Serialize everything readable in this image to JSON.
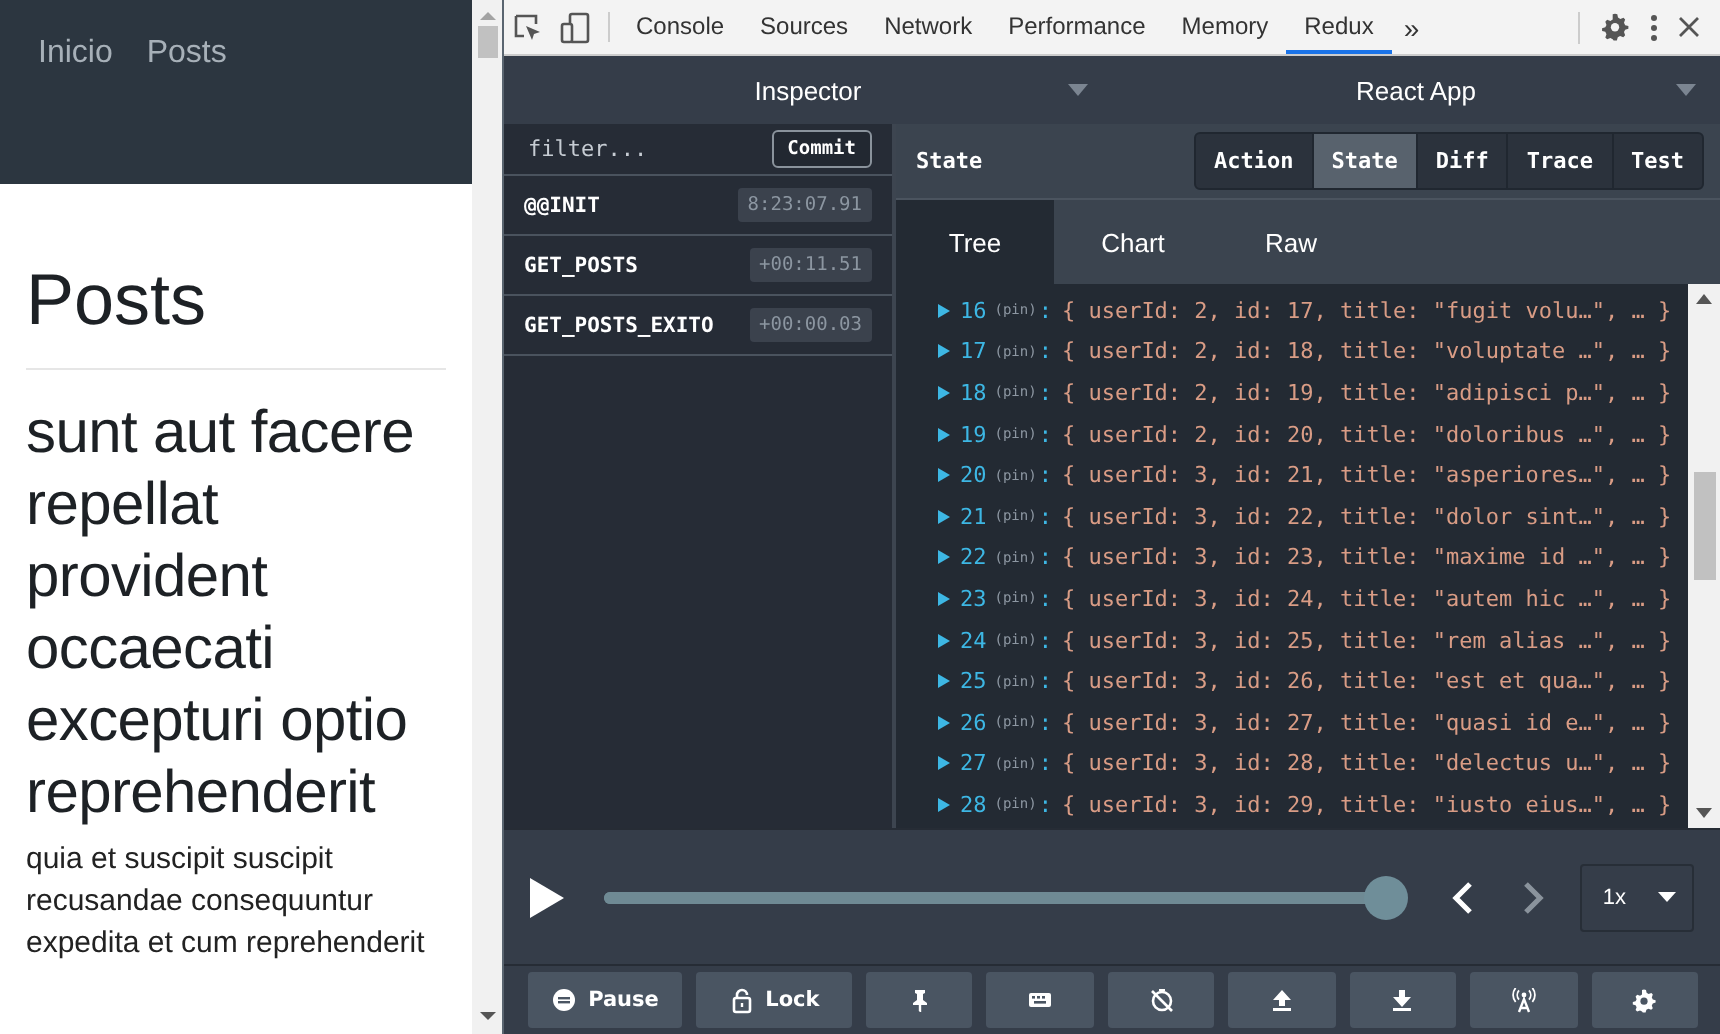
{
  "site": {
    "nav": [
      {
        "label": "Inicio"
      },
      {
        "label": "Posts"
      }
    ],
    "heading": "Posts",
    "post_title": "sunt aut facere repellat provident occaecati excepturi optio reprehenderit",
    "post_body": "quia et suscipit suscipit recusandae consequuntur expedita et cum reprehenderit"
  },
  "devtools_tabs": [
    {
      "label": "Console",
      "selected": false
    },
    {
      "label": "Sources",
      "selected": false
    },
    {
      "label": "Network",
      "selected": false
    },
    {
      "label": "Performance",
      "selected": false
    },
    {
      "label": "Memory",
      "selected": false
    },
    {
      "label": "Redux",
      "selected": true
    }
  ],
  "more_tabs": "»",
  "redux": {
    "monitor": "Inspector",
    "instance": "React App",
    "filter": {
      "placeholder": "filter..."
    },
    "commit": "Commit",
    "actions": [
      {
        "name": "@@INIT",
        "time": "8:23:07.91"
      },
      {
        "name": "GET_POSTS",
        "time": "+00:11.51"
      },
      {
        "name": "GET_POSTS_EXITO",
        "time": "+00:00.03"
      }
    ],
    "pane_title": "State",
    "modes": [
      {
        "label": "Action",
        "selected": false
      },
      {
        "label": "State",
        "selected": true
      },
      {
        "label": "Diff",
        "selected": false
      },
      {
        "label": "Trace",
        "selected": false
      },
      {
        "label": "Test",
        "selected": false
      }
    ],
    "views": [
      {
        "label": "Tree",
        "selected": true
      },
      {
        "label": "Chart",
        "selected": false
      },
      {
        "label": "Raw",
        "selected": false
      }
    ],
    "tree_separator": ":",
    "tree": [
      {
        "key": "16",
        "note": "(pin)",
        "value": "{ userId: 2, id: 17, title: \"fugit volu…\", … }"
      },
      {
        "key": "17",
        "note": "(pin)",
        "value": "{ userId: 2, id: 18, title: \"voluptate …\", … }"
      },
      {
        "key": "18",
        "note": "(pin)",
        "value": "{ userId: 2, id: 19, title: \"adipisci p…\", … }"
      },
      {
        "key": "19",
        "note": "(pin)",
        "value": "{ userId: 2, id: 20, title: \"doloribus …\", … }"
      },
      {
        "key": "20",
        "note": "(pin)",
        "value": "{ userId: 3, id: 21, title: \"asperiores…\", … }"
      },
      {
        "key": "21",
        "note": "(pin)",
        "value": "{ userId: 3, id: 22, title: \"dolor sint…\", … }"
      },
      {
        "key": "22",
        "note": "(pin)",
        "value": "{ userId: 3, id: 23, title: \"maxime id …\", … }"
      },
      {
        "key": "23",
        "note": "(pin)",
        "value": "{ userId: 3, id: 24, title: \"autem hic …\", … }"
      },
      {
        "key": "24",
        "note": "(pin)",
        "value": "{ userId: 3, id: 25, title: \"rem alias …\", … }"
      },
      {
        "key": "25",
        "note": "(pin)",
        "value": "{ userId: 3, id: 26, title: \"est et qua…\", … }"
      },
      {
        "key": "26",
        "note": "(pin)",
        "value": "{ userId: 3, id: 27, title: \"quasi id e…\", … }"
      },
      {
        "key": "27",
        "note": "(pin)",
        "value": "{ userId: 3, id: 28, title: \"delectus u…\", … }"
      },
      {
        "key": "28",
        "note": "(pin)",
        "value": "{ userId: 3, id: 29, title: \"iusto eius…\", … }"
      }
    ],
    "slider": {
      "level": 1.0
    },
    "speed": "1x",
    "toolbar": [
      {
        "kind": "pause",
        "label": "Pause"
      },
      {
        "kind": "lock",
        "label": "Lock"
      },
      {
        "kind": "pin"
      },
      {
        "kind": "keyboard"
      },
      {
        "kind": "timer-off"
      },
      {
        "kind": "upload"
      },
      {
        "kind": "download"
      },
      {
        "kind": "remote"
      },
      {
        "kind": "settings"
      }
    ]
  }
}
